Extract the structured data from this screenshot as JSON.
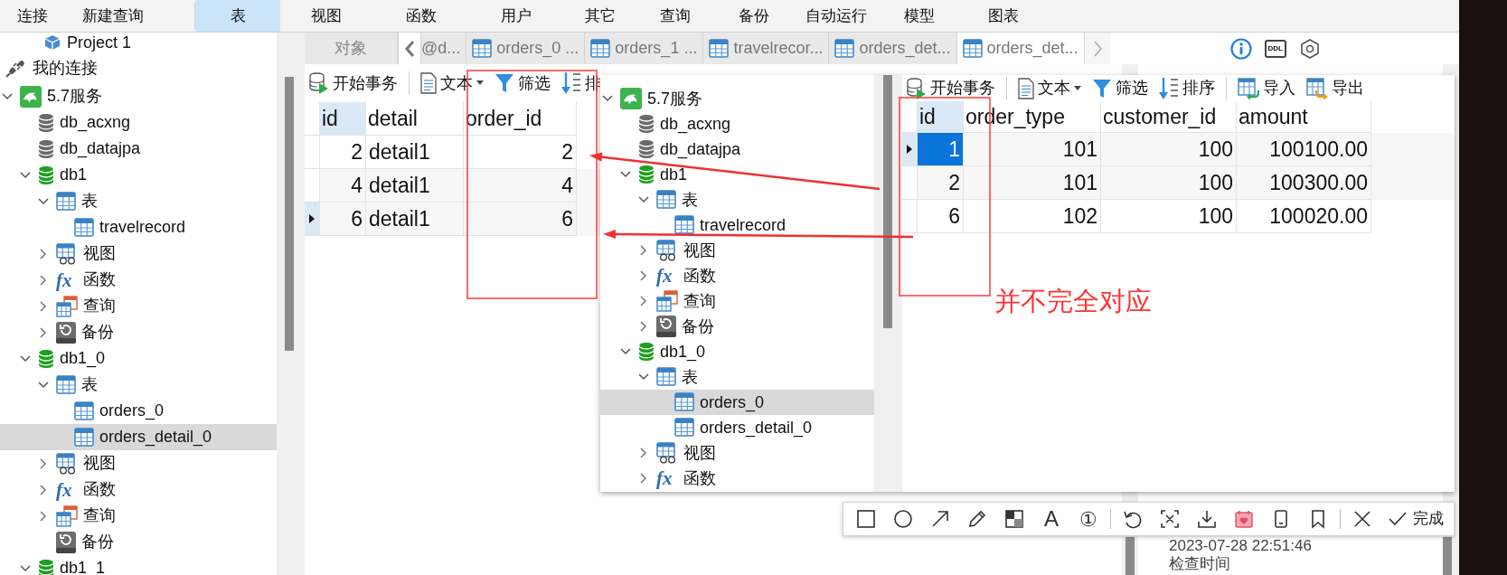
{
  "menu_bar": [
    {
      "label": "连接",
      "selected": false
    },
    {
      "label": "新建查询",
      "selected": false
    },
    {
      "label": "表",
      "selected": true
    },
    {
      "label": "视图",
      "selected": false
    },
    {
      "label": "函数",
      "selected": false
    },
    {
      "label": "用户",
      "selected": false
    },
    {
      "label": "其它",
      "selected": false
    },
    {
      "label": "查询",
      "selected": false
    },
    {
      "label": "备份",
      "selected": false
    },
    {
      "label": "自动运行",
      "selected": false
    },
    {
      "label": "模型",
      "selected": false
    },
    {
      "label": "图表",
      "selected": false
    }
  ],
  "sidebar": {
    "project": "Project 1",
    "connection_group": "我的连接",
    "tree": [
      {
        "label": "5.7服务",
        "kind": "connection",
        "expanded": true,
        "selected": false,
        "children": [
          {
            "label": "db_acxng",
            "kind": "database",
            "connected": false,
            "selected": false
          },
          {
            "label": "db_datajpa",
            "kind": "database",
            "connected": false,
            "selected": false
          },
          {
            "label": "db1",
            "kind": "database",
            "connected": true,
            "expanded": true,
            "selected": false,
            "children": [
              {
                "label": "表",
                "kind": "tables",
                "expanded": true,
                "selected": false,
                "children": [
                  {
                    "label": "travelrecord",
                    "kind": "table",
                    "selected": false
                  }
                ]
              },
              {
                "label": "视图",
                "kind": "views",
                "expanded": false,
                "selected": false
              },
              {
                "label": "函数",
                "kind": "functions",
                "glyph": "fx",
                "expanded": false,
                "selected": false
              },
              {
                "label": "查询",
                "kind": "queries",
                "expanded": false,
                "selected": false
              },
              {
                "label": "备份",
                "kind": "backups",
                "expanded": false,
                "selected": false
              }
            ]
          },
          {
            "label": "db1_0",
            "kind": "database",
            "connected": true,
            "expanded": true,
            "selected": false,
            "children": [
              {
                "label": "表",
                "kind": "tables",
                "expanded": true,
                "selected": false,
                "children": [
                  {
                    "label": "orders_0",
                    "kind": "table",
                    "selected": false
                  },
                  {
                    "label": "orders_detail_0",
                    "kind": "table",
                    "selected": true
                  }
                ]
              },
              {
                "label": "视图",
                "kind": "views",
                "expanded": false,
                "selected": false
              },
              {
                "label": "函数",
                "kind": "functions",
                "glyph": "fx",
                "expanded": false,
                "selected": false
              },
              {
                "label": "查询",
                "kind": "queries",
                "expanded": false,
                "selected": false
              },
              {
                "label": "备份",
                "kind": "backups",
                "selected": false
              }
            ]
          },
          {
            "label": "db1_1",
            "kind": "database",
            "connected": true,
            "expanded": true,
            "selected": false
          }
        ]
      }
    ]
  },
  "tabs": [
    {
      "label": "对象",
      "kind": "objects",
      "selected": false
    },
    {
      "label": "@d...",
      "kind": "partial",
      "selected": false
    },
    {
      "label": "orders_0 ...",
      "kind": "table",
      "selected": false
    },
    {
      "label": "orders_1 ...",
      "kind": "table",
      "selected": false
    },
    {
      "label": "travelrecor...",
      "kind": "table",
      "selected": false
    },
    {
      "label": "orders_det...",
      "kind": "table",
      "selected": false
    },
    {
      "label": "orders_det...",
      "kind": "table",
      "selected": true
    }
  ],
  "ddl_label": "DDL",
  "toolbar": [
    {
      "label": "开始事务",
      "kind": "transaction",
      "dropdown": false,
      "separator_after": true
    },
    {
      "label": "文本",
      "kind": "text",
      "dropdown": true,
      "separator_after": false
    },
    {
      "label": "筛选",
      "kind": "filter",
      "dropdown": false,
      "separator_after": false
    },
    {
      "label": "排",
      "kind": "sort",
      "dropdown": false,
      "separator_after": false
    }
  ],
  "grid": {
    "columns": [
      {
        "label": "id",
        "selected": true,
        "numeric": true
      },
      {
        "label": "detail",
        "selected": false,
        "numeric": false
      },
      {
        "label": "order_id",
        "selected": false,
        "numeric": true
      }
    ],
    "rows": [
      {
        "current": false,
        "cells": [
          {
            "text": "2",
            "selected": false
          },
          {
            "text": "detail1",
            "selected": false
          },
          {
            "text": "2",
            "selected": false
          }
        ]
      },
      {
        "current": false,
        "cells": [
          {
            "text": "4",
            "selected": false
          },
          {
            "text": "detail1",
            "selected": false
          },
          {
            "text": "4",
            "selected": false
          }
        ]
      },
      {
        "current": true,
        "cells": [
          {
            "text": "6",
            "selected": false
          },
          {
            "text": "detail1",
            "selected": false
          },
          {
            "text": "6",
            "selected": false
          }
        ]
      }
    ]
  },
  "info_panel": {
    "value": "2023-07-28 22:51:46",
    "label": "检查时间"
  },
  "pasted_window": {
    "tree": [
      {
        "label": "5.7服务",
        "kind": "connection",
        "expanded": true,
        "selected": false,
        "children": [
          {
            "label": "db_acxng",
            "kind": "database",
            "connected": false,
            "selected": false
          },
          {
            "label": "db_datajpa",
            "kind": "database",
            "connected": false,
            "selected": false
          },
          {
            "label": "db1",
            "kind": "database",
            "connected": true,
            "expanded": true,
            "selected": false,
            "children": [
              {
                "label": "表",
                "kind": "tables",
                "expanded": true,
                "selected": false,
                "children": [
                  {
                    "label": "travelrecord",
                    "kind": "table",
                    "selected": false
                  }
                ]
              },
              {
                "label": "视图",
                "kind": "views",
                "expanded": false,
                "selected": false
              },
              {
                "label": "函数",
                "kind": "functions",
                "glyph": "fx",
                "expanded": false,
                "selected": false
              },
              {
                "label": "查询",
                "kind": "queries",
                "expanded": false,
                "selected": false
              },
              {
                "label": "备份",
                "kind": "backups",
                "expanded": false,
                "selected": false
              }
            ]
          },
          {
            "label": "db1_0",
            "kind": "database",
            "connected": true,
            "expanded": true,
            "selected": false,
            "children": [
              {
                "label": "表",
                "kind": "tables",
                "expanded": true,
                "selected": false,
                "children": [
                  {
                    "label": "orders_0",
                    "kind": "table",
                    "selected": true
                  },
                  {
                    "label": "orders_detail_0",
                    "kind": "table",
                    "selected": false
                  }
                ]
              },
              {
                "label": "视图",
                "kind": "views",
                "expanded": false,
                "selected": false
              },
              {
                "label": "函数",
                "kind": "functions",
                "glyph": "fx",
                "expanded": false,
                "selected": false
              }
            ]
          }
        ]
      }
    ],
    "toolbar": [
      {
        "label": "开始事务",
        "kind": "transaction",
        "dropdown": false,
        "separator_after": true
      },
      {
        "label": "文本",
        "kind": "text",
        "dropdown": true,
        "separator_after": false
      },
      {
        "label": "筛选",
        "kind": "filter",
        "dropdown": false,
        "separator_after": false
      },
      {
        "label": "排序",
        "kind": "sort",
        "dropdown": false,
        "separator_after": true
      },
      {
        "label": "导入",
        "kind": "import",
        "dropdown": false,
        "separator_after": false
      },
      {
        "label": "导出",
        "kind": "export",
        "dropdown": false,
        "separator_after": false
      }
    ],
    "grid": {
      "columns": [
        {
          "label": "id",
          "selected": true,
          "numeric": true
        },
        {
          "label": "order_type",
          "selected": false,
          "numeric": true
        },
        {
          "label": "customer_id",
          "selected": false,
          "numeric": true
        },
        {
          "label": "amount",
          "selected": false,
          "numeric": true
        }
      ],
      "rows": [
        {
          "current": true,
          "cells": [
            {
              "text": "1",
              "selected": true
            },
            {
              "text": "101",
              "selected": false
            },
            {
              "text": "100",
              "selected": false
            },
            {
              "text": "100100.00",
              "selected": false
            }
          ]
        },
        {
          "current": false,
          "cells": [
            {
              "text": "2",
              "selected": false
            },
            {
              "text": "101",
              "selected": false
            },
            {
              "text": "100",
              "selected": false
            },
            {
              "text": "100300.00",
              "selected": false
            }
          ]
        },
        {
          "current": false,
          "cells": [
            {
              "text": "6",
              "selected": false
            },
            {
              "text": "102",
              "selected": false
            },
            {
              "text": "100",
              "selected": false
            },
            {
              "text": "100020.00",
              "selected": false
            }
          ]
        }
      ]
    }
  },
  "annotation": {
    "note": "并不完全对应"
  },
  "capture_toolbar": {
    "text_tool": "A",
    "counter_tool": "①",
    "done": "完成"
  }
}
